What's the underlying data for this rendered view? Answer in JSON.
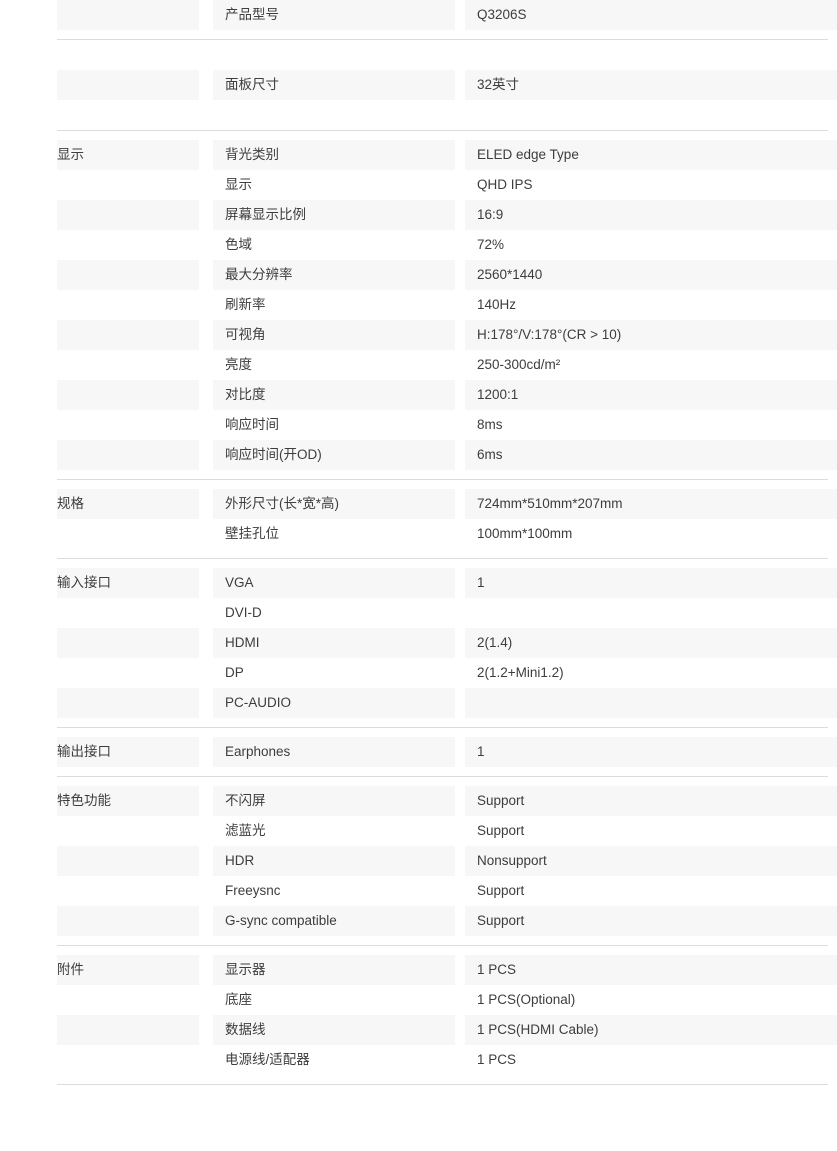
{
  "colors": {
    "row_shade": "#f7f7f7",
    "divider": "#dcdcdc",
    "text": "#3d3d3d",
    "page_background": "#ffffff"
  },
  "sections": [
    {
      "category": "",
      "rows": [
        {
          "parameter": "产品型号",
          "value": "Q3206S"
        }
      ]
    },
    {
      "category": "",
      "rows": [
        {
          "parameter": "面板尺寸",
          "value": "32英寸"
        }
      ]
    },
    {
      "category": "显示",
      "rows": [
        {
          "parameter": "背光类别",
          "value": "ELED edge Type"
        },
        {
          "parameter": "显示",
          "value": "QHD IPS"
        },
        {
          "parameter": "屏幕显示比例",
          "value": "16:9"
        },
        {
          "parameter": "色域",
          "value": "72%"
        },
        {
          "parameter": "最大分辨率",
          "value": "2560*1440"
        },
        {
          "parameter": "刷新率",
          "value": "140Hz"
        },
        {
          "parameter": "可视角",
          "value": "H:178°/V:178°(CR > 10)"
        },
        {
          "parameter": "亮度",
          "value": "250-300cd/m²"
        },
        {
          "parameter": "对比度",
          "value": "1200:1"
        },
        {
          "parameter": "响应时间",
          "value": "8ms"
        },
        {
          "parameter": "响应时间(开OD)",
          "value": "6ms"
        }
      ]
    },
    {
      "category": "规格",
      "rows": [
        {
          "parameter": "外形尺寸(长*宽*高)",
          "value": "724mm*510mm*207mm"
        },
        {
          "parameter": "壁挂孔位",
          "value": "100mm*100mm"
        }
      ]
    },
    {
      "category": "输入接口",
      "rows": [
        {
          "parameter": "VGA",
          "value": "1"
        },
        {
          "parameter": "DVI-D",
          "value": ""
        },
        {
          "parameter": "HDMI",
          "value": "2(1.4)"
        },
        {
          "parameter": "DP",
          "value": "2(1.2+Mini1.2)"
        },
        {
          "parameter": "PC-AUDIO",
          "value": ""
        }
      ]
    },
    {
      "category": "输出接口",
      "rows": [
        {
          "parameter": "Earphones",
          "value": "1"
        }
      ]
    },
    {
      "category": "特色功能",
      "rows": [
        {
          "parameter": "不闪屏",
          "value": "Support"
        },
        {
          "parameter": "滤蓝光",
          "value": "Support"
        },
        {
          "parameter": "HDR",
          "value": "Nonsupport"
        },
        {
          "parameter": "Freeysnc",
          "value": "Support"
        },
        {
          "parameter": "G-sync compatible",
          "value": "Support"
        }
      ]
    },
    {
      "category": "附件",
      "rows": [
        {
          "parameter": "显示器",
          "value": "1 PCS"
        },
        {
          "parameter": "底座",
          "value": "1 PCS(Optional)"
        },
        {
          "parameter": "数据线",
          "value": "1 PCS(HDMI Cable)"
        },
        {
          "parameter": "电源线/适配器",
          "value": "1 PCS"
        }
      ]
    }
  ]
}
